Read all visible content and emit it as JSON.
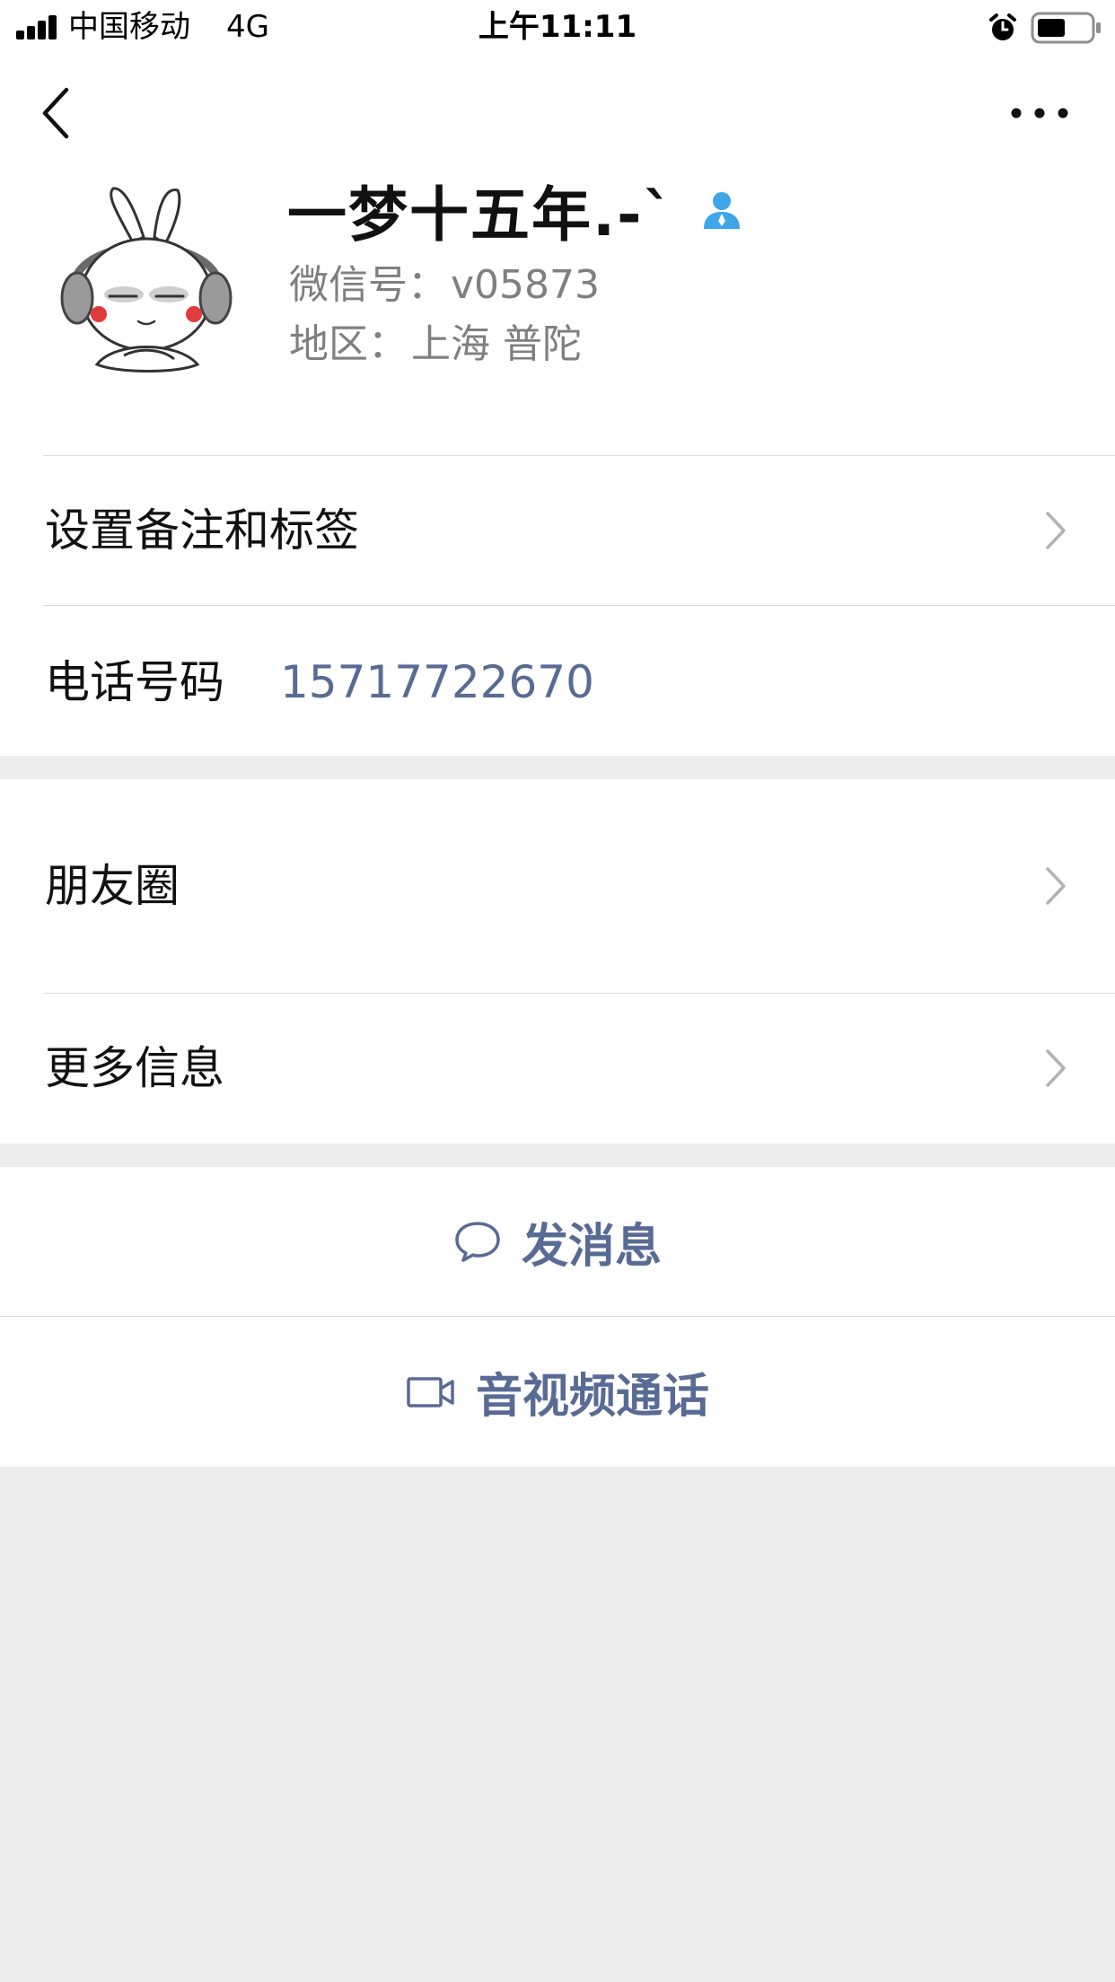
{
  "status_bar": {
    "carrier": "中国移动",
    "network": "4G",
    "time": "上午11:11"
  },
  "profile": {
    "name": "一梦十五年.-`",
    "wechat_id_label": "微信号：",
    "wechat_id": "v05873",
    "region_label": "地区：",
    "region": "上海 普陀"
  },
  "rows": {
    "remark_tags": "设置备注和标签",
    "phone_label": "电话号码",
    "phone_value": "15717722670",
    "moments": "朋友圈",
    "more_info": "更多信息"
  },
  "actions": {
    "send_message": "发消息",
    "av_call": "音视频通话"
  },
  "colors": {
    "link": "#586b95",
    "background": "#ededed",
    "gender_icon": "#3ea6e8"
  }
}
